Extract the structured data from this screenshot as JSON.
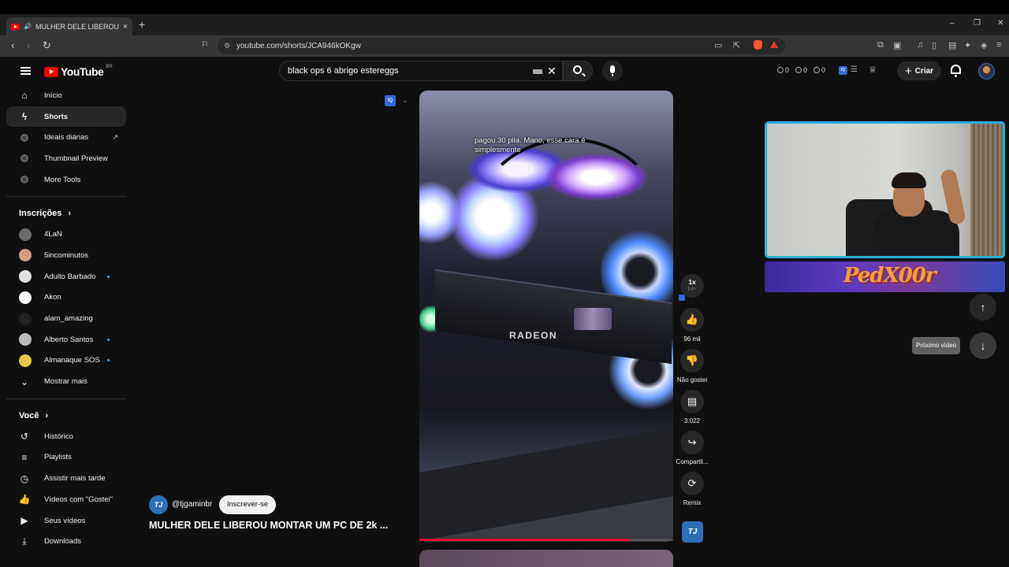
{
  "browser": {
    "tab_title": "MULHER DELE LIBEROU MON",
    "url": "youtube.com/shorts/JCA946kOKgw",
    "new_tab": "+",
    "tab_close": "×",
    "win_min": "–",
    "win_max": "❐",
    "win_close": "✕"
  },
  "youtube": {
    "logo_text": "YouTube",
    "country_code": "BR",
    "search_value": "black ops 6 abrigo estereggs",
    "counters": [
      "0",
      "0",
      "0"
    ],
    "create_label": "Criar"
  },
  "sidebar": {
    "main": [
      {
        "label": "Início",
        "icon": "home-icon"
      },
      {
        "label": "Shorts",
        "icon": "shorts-icon"
      },
      {
        "label": "Ideais diárias",
        "icon": "extension-icon"
      },
      {
        "label": "Thumbnail Preview",
        "icon": "extension-icon"
      },
      {
        "label": "More Tools",
        "icon": "extension-icon"
      }
    ],
    "subscriptions_heading": "Inscrições",
    "subscriptions": [
      {
        "label": "4LaN",
        "live": false,
        "color": "#6a6a6a"
      },
      {
        "label": "5incominutos",
        "live": false,
        "color": "#d89a80"
      },
      {
        "label": "Adulto Barbado",
        "live": true,
        "color": "#e0e0e0"
      },
      {
        "label": "Akon",
        "live": false,
        "color": "#ffffff"
      },
      {
        "label": "alam_amazing",
        "live": false,
        "color": "#222222"
      },
      {
        "label": "Alberto Santos",
        "live": true,
        "color": "#bbbbbb"
      },
      {
        "label": "Almanaque SOS",
        "live": true,
        "color": "#e8c840"
      }
    ],
    "show_more": "Mostrar mais",
    "you_heading": "Você",
    "you": [
      {
        "label": "Histórico",
        "icon": "history-icon"
      },
      {
        "label": "Playlists",
        "icon": "playlists-icon"
      },
      {
        "label": "Assistir mais tarde",
        "icon": "watch-later-icon"
      },
      {
        "label": "Vídeos com \"Gostei\"",
        "icon": "like-icon"
      },
      {
        "label": "Seus vídeos",
        "icon": "your-videos-icon"
      },
      {
        "label": "Downloads",
        "icon": "download-icon"
      }
    ]
  },
  "short": {
    "caption": "pagou 30 pila. Mano, esse cara é simplesmente",
    "channel_handle": "@tjgaminbr",
    "channel_initials": "TJ",
    "subscribe_label": "Inscrever-se",
    "title": "MULHER DELE LIBEROU MONTAR UM PC DE 2k ...",
    "gpu_brand": "RADEON",
    "progress": 0.83,
    "speed": "1x",
    "likes": "96 mil",
    "dislike_label": "Não gostei",
    "comments": "3.022",
    "share_label": "Compartil...",
    "remix_label": "Remix",
    "next_tooltip": "Próximo vídeo"
  },
  "overlay": {
    "banner_text": "PedX00r",
    "border_color": "#2bb0d8"
  },
  "colors": {
    "brand_red": "#ff0000",
    "progress_red": "#ff0033",
    "background": "#0f0f0f"
  }
}
